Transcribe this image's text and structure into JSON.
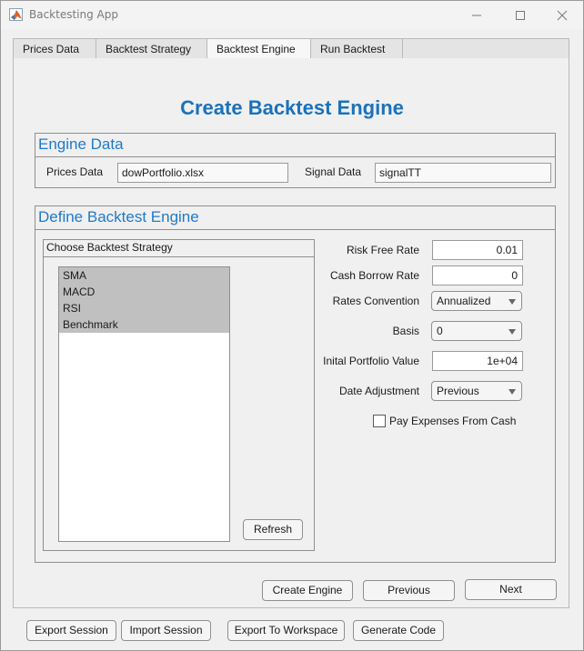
{
  "window": {
    "title": "Backtesting App",
    "controls": [
      "minimize",
      "maximize",
      "close"
    ]
  },
  "tabs": [
    {
      "label": "Prices Data",
      "active": false
    },
    {
      "label": "Backtest Strategy",
      "active": false
    },
    {
      "label": "Backtest Engine",
      "active": true
    },
    {
      "label": "Run Backtest",
      "active": false
    }
  ],
  "page": {
    "title": "Create Backtest Engine"
  },
  "engine_data": {
    "title": "Engine Data",
    "prices_label": "Prices Data",
    "prices_value": "dowPortfolio.xlsx",
    "signal_label": "Signal Data",
    "signal_value": "signalTT"
  },
  "define_engine": {
    "title": "Define Backtest Engine",
    "strategy_panel_title": "Choose Backtest Strategy",
    "strategies": [
      "SMA",
      "MACD",
      "RSI",
      "Benchmark"
    ],
    "refresh_label": "Refresh",
    "risk_free_rate_label": "Risk Free Rate",
    "risk_free_rate_value": "0.01",
    "cash_borrow_rate_label": "Cash Borrow Rate",
    "cash_borrow_rate_value": "0",
    "rates_convention_label": "Rates Convention",
    "rates_convention_value": "Annualized",
    "basis_label": "Basis",
    "basis_value": "0",
    "initial_portfolio_label": "Inital Portfolio Value",
    "initial_portfolio_value": "1e+04",
    "date_adjustment_label": "Date Adjustment",
    "date_adjustment_value": "Previous",
    "pay_expenses_label": "Pay Expenses From Cash",
    "pay_expenses_checked": false
  },
  "nav_buttons": {
    "create_engine": "Create Engine",
    "previous": "Previous",
    "next": "Next"
  },
  "footer_buttons": {
    "export_session": "Export Session",
    "import_session": "Import Session",
    "export_workspace": "Export To Workspace",
    "generate_code": "Generate Code"
  }
}
